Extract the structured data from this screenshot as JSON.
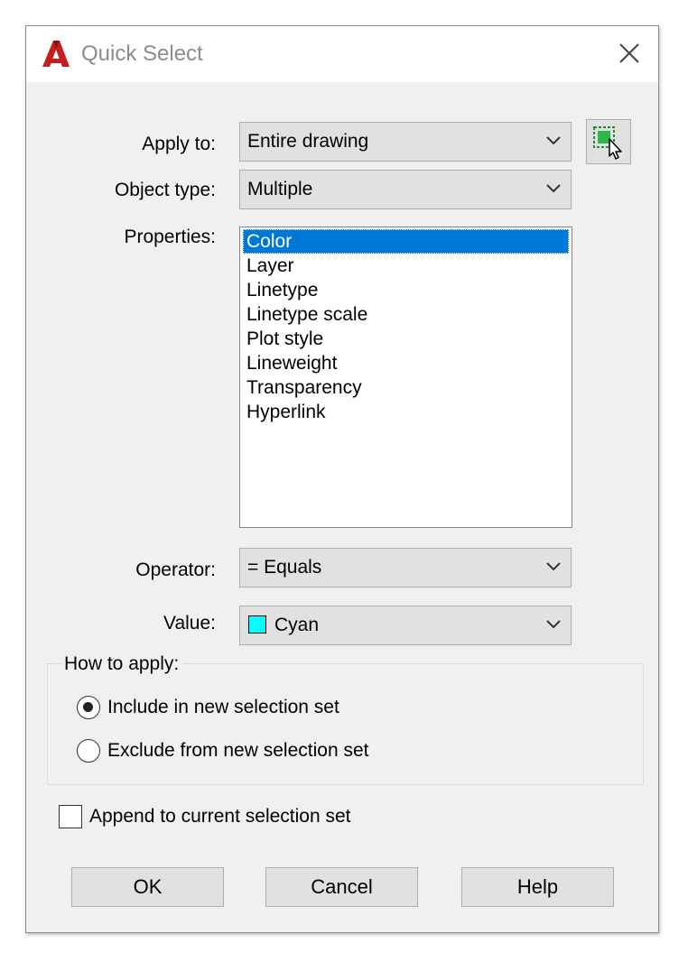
{
  "window": {
    "title": "Quick Select",
    "app_icon": "autocad-logo-icon",
    "close_icon": "close-icon",
    "accent_color": "#c41e1e"
  },
  "form": {
    "apply_to": {
      "label": "Apply to:",
      "value": "Entire drawing"
    },
    "select_objects_icon": "select-objects-icon",
    "object_type": {
      "label": "Object type:",
      "value": "Multiple"
    },
    "properties": {
      "label": "Properties:",
      "items": [
        "Color",
        "Layer",
        "Linetype",
        "Linetype scale",
        "Plot style",
        "Lineweight",
        "Transparency",
        "Hyperlink"
      ],
      "selected": "Color",
      "selected_color": "#0078d7"
    },
    "operator": {
      "label": "Operator:",
      "value": "= Equals"
    },
    "value": {
      "label": "Value:",
      "value": "Cyan",
      "swatch_color": "#00ffff"
    }
  },
  "how_to_apply": {
    "legend": "How to apply:",
    "include": {
      "label": "Include in new selection set",
      "checked": true
    },
    "exclude": {
      "label": "Exclude from new selection set",
      "checked": false
    }
  },
  "append": {
    "label": "Append to current selection set",
    "checked": false
  },
  "buttons": {
    "ok": "OK",
    "cancel": "Cancel",
    "help": "Help"
  }
}
